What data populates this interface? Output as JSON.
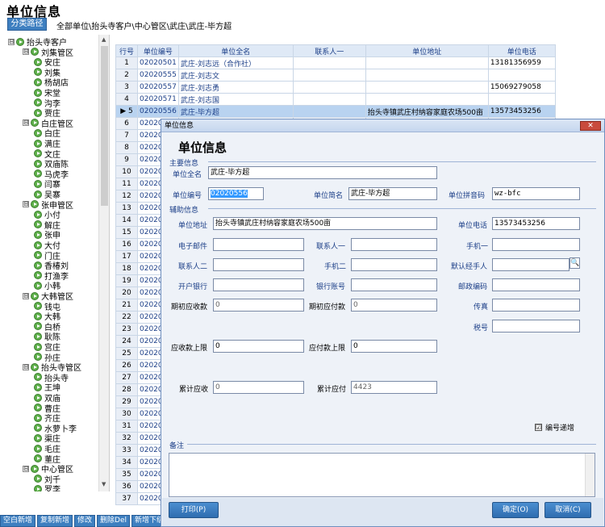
{
  "page": {
    "title": "单位信息",
    "crumb_button": "分类路径",
    "crumb_path": "全部单位\\抬头寺客户\\中心管区\\武庄\\武庄-毕方超"
  },
  "tree": [
    {
      "label": "抬头寺客户",
      "level": 0,
      "toggle": "⊟"
    },
    {
      "label": "刘集管区",
      "level": 1,
      "toggle": "⊟"
    },
    {
      "label": "安庄",
      "level": 2
    },
    {
      "label": "刘集",
      "level": 2
    },
    {
      "label": "杨胡店",
      "level": 2
    },
    {
      "label": "宋堂",
      "level": 2
    },
    {
      "label": "沟李",
      "level": 2
    },
    {
      "label": "贾庄",
      "level": 2
    },
    {
      "label": "白庄管区",
      "level": 1,
      "toggle": "⊟"
    },
    {
      "label": "白庄",
      "level": 2
    },
    {
      "label": "满庄",
      "level": 2
    },
    {
      "label": "文庄",
      "level": 2
    },
    {
      "label": "双庙陈",
      "level": 2
    },
    {
      "label": "马虎李",
      "level": 2
    },
    {
      "label": "闫寨",
      "level": 2
    },
    {
      "label": "吴寨",
      "level": 2
    },
    {
      "label": "张申管区",
      "level": 1,
      "toggle": "⊟"
    },
    {
      "label": "小付",
      "level": 2
    },
    {
      "label": "解庄",
      "level": 2
    },
    {
      "label": "张申",
      "level": 2
    },
    {
      "label": "大付",
      "level": 2
    },
    {
      "label": "门庄",
      "level": 2
    },
    {
      "label": "香椿刘",
      "level": 2
    },
    {
      "label": "打渔李",
      "level": 2
    },
    {
      "label": "小韩",
      "level": 2
    },
    {
      "label": "大韩管区",
      "level": 1,
      "toggle": "⊟"
    },
    {
      "label": "钱屯",
      "level": 2
    },
    {
      "label": "大韩",
      "level": 2
    },
    {
      "label": "白桥",
      "level": 2
    },
    {
      "label": "耿陈",
      "level": 2
    },
    {
      "label": "宫庄",
      "level": 2
    },
    {
      "label": "孙庄",
      "level": 2
    },
    {
      "label": "抬头寺管区",
      "level": 1,
      "toggle": "⊟"
    },
    {
      "label": "抬头寺",
      "level": 2
    },
    {
      "label": "王坤",
      "level": 2
    },
    {
      "label": "双庙",
      "level": 2
    },
    {
      "label": "曹庄",
      "level": 2
    },
    {
      "label": "齐庄",
      "level": 2
    },
    {
      "label": "水萝卜李",
      "level": 2
    },
    {
      "label": "渠庄",
      "level": 2
    },
    {
      "label": "毛庄",
      "level": 2
    },
    {
      "label": "董庄",
      "level": 2
    },
    {
      "label": "中心管区",
      "level": 1,
      "toggle": "⊟"
    },
    {
      "label": "刘千",
      "level": 2
    },
    {
      "label": "罗李",
      "level": 2
    }
  ],
  "grid": {
    "headers": [
      "行号",
      "单位编号",
      "单位全名",
      "联系人一",
      "单位地址",
      "单位电话"
    ],
    "rows": [
      {
        "n": "1",
        "code": "02020501",
        "name": "武庄-刘志远（合作社）",
        "contact": "",
        "addr": "",
        "phone": "13181356959"
      },
      {
        "n": "2",
        "code": "02020555",
        "name": "武庄-刘志文",
        "contact": "",
        "addr": "",
        "phone": ""
      },
      {
        "n": "3",
        "code": "02020557",
        "name": "武庄-刘志勇",
        "contact": "",
        "addr": "",
        "phone": "15069279058"
      },
      {
        "n": "4",
        "code": "02020571",
        "name": "武庄-刘志国",
        "contact": "",
        "addr": "",
        "phone": ""
      },
      {
        "n": "5",
        "code": "02020556",
        "name": "武庄-毕方超",
        "contact": "",
        "addr": "抬头寺镇武庄村纳容家庭农场500亩",
        "phone": "13573453256",
        "sel": true
      },
      {
        "n": "6",
        "code": "02020",
        "name": "",
        "contact": "",
        "addr": "",
        "phone": ""
      },
      {
        "n": "7",
        "code": "02020",
        "name": "",
        "contact": "",
        "addr": "",
        "phone": ""
      },
      {
        "n": "8",
        "code": "02020",
        "name": "",
        "contact": "",
        "addr": "",
        "phone": ""
      },
      {
        "n": "9",
        "code": "02020",
        "name": "",
        "contact": "",
        "addr": "",
        "phone": ""
      },
      {
        "n": "10",
        "code": "02020",
        "name": "",
        "contact": "",
        "addr": "",
        "phone": ""
      },
      {
        "n": "11",
        "code": "02020",
        "name": "",
        "contact": "",
        "addr": "",
        "phone": ""
      },
      {
        "n": "12",
        "code": "02020",
        "name": "",
        "contact": "",
        "addr": "",
        "phone": ""
      },
      {
        "n": "13",
        "code": "02020",
        "name": "",
        "contact": "",
        "addr": "",
        "phone": ""
      },
      {
        "n": "14",
        "code": "02020",
        "name": "",
        "contact": "",
        "addr": "",
        "phone": ""
      },
      {
        "n": "15",
        "code": "02020",
        "name": "",
        "contact": "",
        "addr": "",
        "phone": ""
      },
      {
        "n": "16",
        "code": "02020",
        "name": "",
        "contact": "",
        "addr": "",
        "phone": ""
      },
      {
        "n": "17",
        "code": "02020",
        "name": "",
        "contact": "",
        "addr": "",
        "phone": ""
      },
      {
        "n": "18",
        "code": "02020",
        "name": "",
        "contact": "",
        "addr": "",
        "phone": ""
      },
      {
        "n": "19",
        "code": "02020",
        "name": "",
        "contact": "",
        "addr": "",
        "phone": ""
      },
      {
        "n": "20",
        "code": "02020",
        "name": "",
        "contact": "",
        "addr": "",
        "phone": ""
      },
      {
        "n": "21",
        "code": "02020",
        "name": "",
        "contact": "",
        "addr": "",
        "phone": ""
      },
      {
        "n": "22",
        "code": "02020",
        "name": "",
        "contact": "",
        "addr": "",
        "phone": ""
      },
      {
        "n": "23",
        "code": "02020",
        "name": "",
        "contact": "",
        "addr": "",
        "phone": ""
      },
      {
        "n": "24",
        "code": "02020",
        "name": "",
        "contact": "",
        "addr": "",
        "phone": ""
      },
      {
        "n": "25",
        "code": "02020",
        "name": "",
        "contact": "",
        "addr": "",
        "phone": ""
      },
      {
        "n": "26",
        "code": "02020",
        "name": "",
        "contact": "",
        "addr": "",
        "phone": ""
      },
      {
        "n": "27",
        "code": "02020",
        "name": "",
        "contact": "",
        "addr": "",
        "phone": ""
      },
      {
        "n": "28",
        "code": "02020",
        "name": "",
        "contact": "",
        "addr": "",
        "phone": ""
      },
      {
        "n": "29",
        "code": "02020",
        "name": "",
        "contact": "",
        "addr": "",
        "phone": ""
      },
      {
        "n": "30",
        "code": "02020",
        "name": "",
        "contact": "",
        "addr": "",
        "phone": ""
      },
      {
        "n": "31",
        "code": "02020",
        "name": "",
        "contact": "",
        "addr": "",
        "phone": ""
      },
      {
        "n": "32",
        "code": "02020",
        "name": "",
        "contact": "",
        "addr": "",
        "phone": ""
      },
      {
        "n": "33",
        "code": "02020",
        "name": "",
        "contact": "",
        "addr": "",
        "phone": ""
      },
      {
        "n": "34",
        "code": "02020",
        "name": "",
        "contact": "",
        "addr": "",
        "phone": ""
      },
      {
        "n": "35",
        "code": "02020",
        "name": "",
        "contact": "",
        "addr": "",
        "phone": ""
      },
      {
        "n": "36",
        "code": "02020",
        "name": "",
        "contact": "",
        "addr": "",
        "phone": ""
      },
      {
        "n": "37",
        "code": "02020",
        "name": "",
        "contact": "",
        "addr": "",
        "phone": ""
      }
    ]
  },
  "bottom_buttons": [
    "空白新增",
    "复制新增",
    "修改",
    "删除Del",
    "新增下级"
  ],
  "dialog": {
    "window_title": "单位信息",
    "close": "✕",
    "heading": "单位信息",
    "sec_main": "主要信息",
    "sec_aux": "辅助信息",
    "sec_memo": "备注",
    "labels": {
      "full_name": "单位全名",
      "code": "单位编号",
      "short_name": "单位简名",
      "pinyin": "单位拼音码",
      "address": "单位地址",
      "phone": "单位电话",
      "email": "电子邮件",
      "contact1": "联系人一",
      "mobile1": "手机一",
      "contact2": "联系人二",
      "mobile2": "手机二",
      "default_handler": "默认经手人",
      "bank": "开户银行",
      "account": "银行账号",
      "postcode": "邮政编码",
      "init_receivable": "期初应收款",
      "init_payable": "期初应付款",
      "fax": "传真",
      "tax": "税号",
      "recv_limit": "应收款上限",
      "pay_limit": "应付款上限",
      "cum_recv": "累计应收",
      "cum_pay": "累计应付"
    },
    "values": {
      "full_name": "武庄-毕方超",
      "code": "02020556",
      "short_name": "武庄-毕方超",
      "pinyin": "wz-bfc",
      "address": "抬头寺镇武庄村纳容家庭农场500亩",
      "phone": "13573453256",
      "init_receivable": "0",
      "init_payable": "0",
      "recv_limit": "0",
      "pay_limit": "0",
      "cum_recv": "0",
      "cum_pay": "4423"
    },
    "checkbox": {
      "label": "编号递增",
      "checked": "☑"
    },
    "lookup_icon": "search-icon",
    "buttons": {
      "print": "打印(P)",
      "ok": "确定(O)",
      "cancel": "取消(C)"
    }
  }
}
